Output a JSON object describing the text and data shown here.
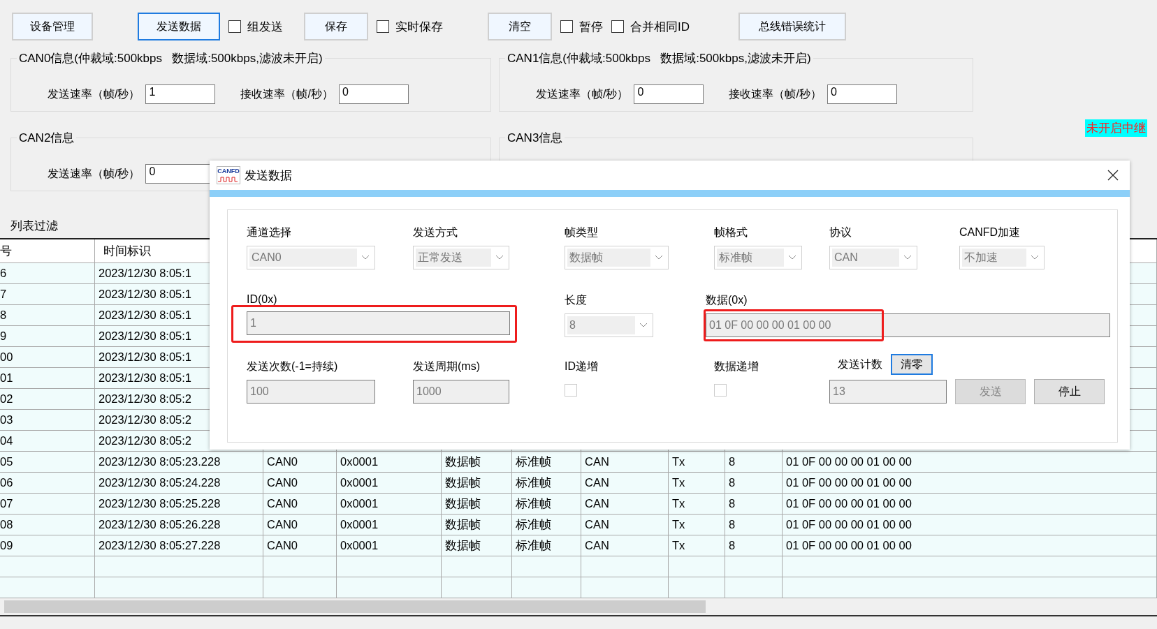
{
  "toolbar": [
    {
      "kind": "button",
      "label": "设备管理",
      "focused": false
    },
    {
      "kind": "button",
      "label": "发送数据",
      "focused": true
    },
    {
      "kind": "checkbox",
      "label": "组发送",
      "checked": false
    },
    {
      "kind": "button",
      "label": "保存",
      "focused": false
    },
    {
      "kind": "checkbox",
      "label": "实时保存",
      "checked": false
    },
    {
      "kind": "button",
      "label": "清空",
      "focused": false
    },
    {
      "kind": "checkbox",
      "label": "暂停",
      "checked": false
    },
    {
      "kind": "checkbox",
      "label": "合并相同ID",
      "checked": false
    },
    {
      "kind": "button",
      "label": "总线错误统计",
      "focused": false
    }
  ],
  "channel_groups": [
    {
      "title": "CAN0信息(仲裁域:500kbps   数据域:500kbps,滤波未开启)",
      "rates": [
        {
          "label": "发送速率（帧/秒）",
          "value": "1"
        },
        {
          "label": "接收速率（帧/秒）",
          "value": "0"
        }
      ]
    },
    {
      "title": "CAN1信息(仲裁域:500kbps   数据域:500kbps,滤波未开启)",
      "rates": [
        {
          "label": "发送速率（帧/秒）",
          "value": "0"
        },
        {
          "label": "接收速率（帧/秒）",
          "value": "0"
        }
      ]
    },
    {
      "title": "CAN2信息",
      "rates": [
        {
          "label": "发送速率（帧/秒）",
          "value": "0"
        }
      ]
    },
    {
      "title": "CAN3信息"
    }
  ],
  "relay_status": "未开启中继",
  "list_filter": "列表过滤",
  "table": {
    "columns": [
      "号",
      "时间标识"
    ],
    "rows": [
      {
        "cells": [
          "6",
          "2023/12/30 8:05:1"
        ]
      },
      {
        "cells": [
          "7",
          "2023/12/30 8:05:1"
        ]
      },
      {
        "cells": [
          "8",
          "2023/12/30 8:05:1"
        ]
      },
      {
        "cells": [
          "9",
          "2023/12/30 8:05:1"
        ]
      },
      {
        "cells": [
          "00",
          "2023/12/30 8:05:1"
        ]
      },
      {
        "cells": [
          "01",
          "2023/12/30 8:05:1"
        ]
      },
      {
        "cells": [
          "02",
          "2023/12/30 8:05:2"
        ]
      },
      {
        "cells": [
          "03",
          "2023/12/30 8:05:2"
        ]
      },
      {
        "cells": [
          "04",
          "2023/12/30 8:05:2"
        ]
      },
      {
        "cells": [
          "05",
          "2023/12/30 8:05:23.228",
          "CAN0",
          "0x0001",
          "数据帧",
          "标准帧",
          "CAN",
          "Tx",
          "8",
          "01 0F 00 00 00 01 00 00"
        ]
      },
      {
        "cells": [
          "06",
          "2023/12/30 8:05:24.228",
          "CAN0",
          "0x0001",
          "数据帧",
          "标准帧",
          "CAN",
          "Tx",
          "8",
          "01 0F 00 00 00 01 00 00"
        ]
      },
      {
        "cells": [
          "07",
          "2023/12/30 8:05:25.228",
          "CAN0",
          "0x0001",
          "数据帧",
          "标准帧",
          "CAN",
          "Tx",
          "8",
          "01 0F 00 00 00 01 00 00"
        ]
      },
      {
        "cells": [
          "08",
          "2023/12/30 8:05:26.228",
          "CAN0",
          "0x0001",
          "数据帧",
          "标准帧",
          "CAN",
          "Tx",
          "8",
          "01 0F 00 00 00 01 00 00"
        ]
      },
      {
        "cells": [
          "09",
          "2023/12/30 8:05:27.228",
          "CAN0",
          "0x0001",
          "数据帧",
          "标准帧",
          "CAN",
          "Tx",
          "8",
          "01 0F 00 00 00 01 00 00"
        ]
      }
    ]
  },
  "dialog": {
    "icon_label": "CANFD",
    "title": "发送数据",
    "combos": [
      {
        "label": "通道选择",
        "value": "CAN0",
        "disabled": true
      },
      {
        "label": "发送方式",
        "value": "正常发送",
        "disabled": true
      },
      {
        "label": "帧类型",
        "value": "数据帧",
        "disabled": true
      },
      {
        "label": "帧格式",
        "value": "标准帧",
        "disabled": true
      },
      {
        "label": "协议",
        "value": "CAN",
        "disabled": true
      },
      {
        "label": "CANFD加速",
        "value": "不加速",
        "disabled": true
      }
    ],
    "id_field": {
      "label": "ID(0x)",
      "value": "1",
      "disabled": true,
      "highlighted": true
    },
    "length": {
      "label": "长度",
      "value": "8",
      "disabled": true
    },
    "data_field": {
      "label": "数据(0x)",
      "value": "01 0F 00 00 00 01 00 00",
      "disabled": true,
      "highlighted": true
    },
    "send_times": {
      "label": "发送次数(-1=持续)",
      "value": "100",
      "disabled": true
    },
    "send_period": {
      "label": "发送周期(ms)",
      "value": "1000",
      "disabled": true
    },
    "id_increment": {
      "label": "ID递增",
      "checked": false,
      "disabled": true
    },
    "data_increment": {
      "label": "数据递增",
      "checked": false,
      "disabled": true
    },
    "send_count": {
      "label": "发送计数",
      "value": "13",
      "disabled": true
    },
    "clear_button": {
      "label": "清零",
      "focused": true
    },
    "send_button": {
      "label": "发送",
      "disabled": true
    },
    "stop_button": {
      "label": "停止",
      "disabled": false
    }
  }
}
